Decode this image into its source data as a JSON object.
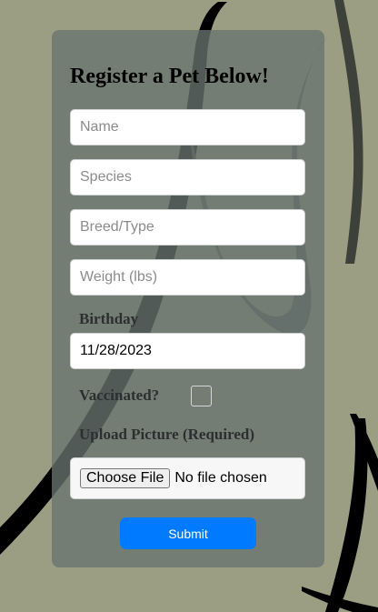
{
  "form": {
    "title": "Register a Pet Below!",
    "name_placeholder": "Name",
    "species_placeholder": "Species",
    "breed_placeholder": "Breed/Type",
    "weight_placeholder": "Weight (lbs)",
    "birthday_label": "Birthday",
    "birthday_value": "11/28/2023",
    "vaccinated_label": "Vaccinated?",
    "vaccinated_checked": false,
    "upload_label": "Upload Picture (Required)",
    "choose_file_label": "Choose File",
    "no_file_text": "No file chosen",
    "submit_label": "Submit"
  },
  "colors": {
    "background": "#9c9e84",
    "card": "#6b7472",
    "submit": "#007bff"
  }
}
